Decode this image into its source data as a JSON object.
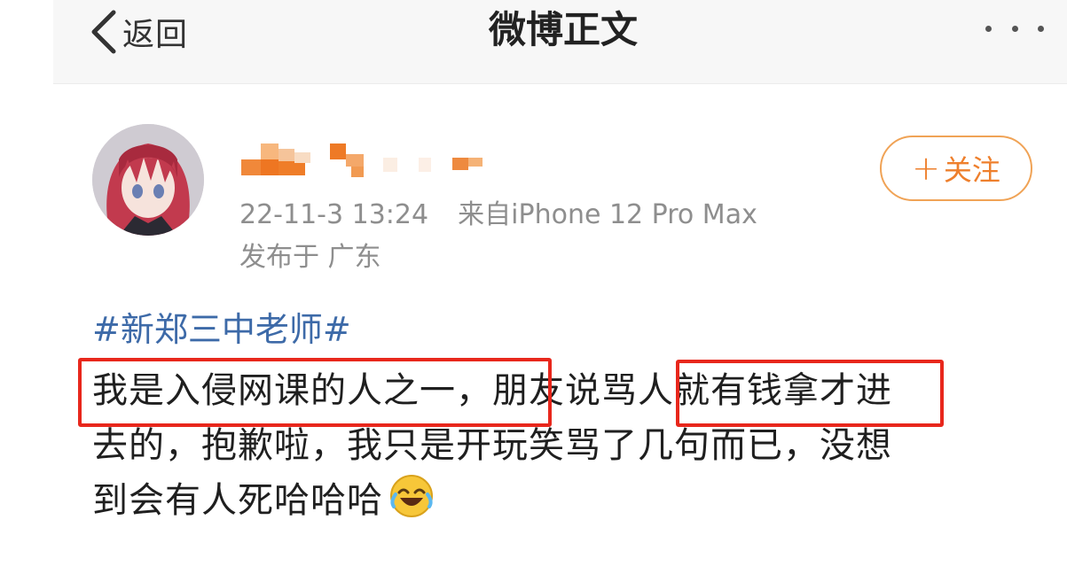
{
  "header": {
    "back_label": "返回",
    "title": "微博正文",
    "more_icon": "more-dots-icon"
  },
  "user": {
    "timestamp": "22-11-3 13:24",
    "source": "来自iPhone 12 Pro Max",
    "location": "发布于 广东",
    "follow_label": "关注",
    "follow_plus": "+"
  },
  "post": {
    "hashtag": "#新郑三中老师#",
    "line1": "我是入侵网课的人之一，朋友说骂人就有钱拿才进",
    "line2": "去的，抱歉啦，我只是开玩笑骂了几句而已，没想",
    "line3": "到会有人死哈哈哈",
    "emoji": "laugh-cry-emoji"
  },
  "colors": {
    "accent_orange": "#ee7f2c",
    "hashtag_blue": "#3d6aa8",
    "annotation_red": "#e8271c"
  }
}
